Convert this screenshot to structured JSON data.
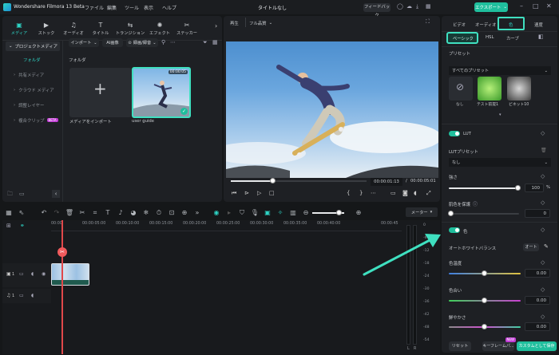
{
  "titlebar": {
    "app": "Wondershare Filmora 13 Beta",
    "menus": [
      "ファイル",
      "編集",
      "ツール",
      "表示",
      "ヘルプ"
    ],
    "project": "タイトルなし",
    "feedback": "フィードバック",
    "export": "エクスポート"
  },
  "media_tabs": [
    {
      "label": "メディア",
      "icon": "media-icon"
    },
    {
      "label": "ストック",
      "icon": "stock-icon"
    },
    {
      "label": "オーディオ",
      "icon": "audio-icon"
    },
    {
      "label": "タイトル",
      "icon": "title-icon"
    },
    {
      "label": "トランジション",
      "icon": "transition-icon"
    },
    {
      "label": "エフェクト",
      "icon": "effect-icon"
    },
    {
      "label": "ステッカー",
      "icon": "sticker-icon"
    }
  ],
  "sidebar": {
    "project_media": "プロジェクトメディア",
    "folder": "フォルダ",
    "items": [
      "共有メディア",
      "クラウド メディア",
      "調整レイヤー",
      "複合クリップ"
    ],
    "beta_badge": "BETA"
  },
  "media_toolbar": {
    "import": "インポート",
    "ai_image": "AI画像",
    "sort": "録画/録音",
    "folder_label": "フォルダ"
  },
  "media_items": [
    {
      "label": "メディアをインポート"
    },
    {
      "label": "user guide",
      "duration": "00:00:05"
    }
  ],
  "player": {
    "tab1": "再生",
    "tab2": "フル品質",
    "current": "00:00:01:13",
    "total": "00:00:05:01"
  },
  "right": {
    "tabs": [
      "ビデオ",
      "オーディオ",
      "色",
      "速度"
    ],
    "subtabs": [
      "ベーシック",
      "HSL",
      "カーブ"
    ],
    "preset_title": "プリセット",
    "preset_select": "すべてのプリセット",
    "presets": [
      "なし",
      "テスト前提1",
      "ビネット10"
    ],
    "lut": "LUT",
    "lut_preset": "LUTプリセット",
    "lut_none": "なし",
    "strength": "強さ",
    "strength_val": "100",
    "strength_pct": "%",
    "skin": "肌色を保護",
    "skin_val": "0",
    "color": "色",
    "white_balance": "オートホワイトバランス",
    "auto": "オート",
    "temp": "色温度",
    "temp_val": "0.00",
    "tint": "色合い",
    "tint_val": "0.00",
    "vivid": "鮮やかさ",
    "vivid_val": "0.00",
    "reset": "リセット",
    "keyframe": "キーフレームパ...",
    "keyframe_badge": "NEW",
    "save_custom": "カスタムとして保存"
  },
  "timeline": {
    "meter": "メーター",
    "times": [
      "00:00",
      "00:00:05:00",
      "00:00:10:00",
      "00:00:15:00",
      "00:00:20:00",
      "00:00:25:00",
      "00:00:30:00",
      "00:00:35:00",
      "00:00:40:00",
      "00:00:45"
    ],
    "db": [
      "0",
      "-6",
      "-12",
      "-18",
      "-24",
      "-30",
      "-36",
      "-42",
      "-48",
      "-54"
    ],
    "lr": [
      "L",
      "R"
    ],
    "track_v": "1",
    "track_a": "1"
  },
  "colors": {
    "accent": "#1fbf9d",
    "highlight": "#3fe0c0"
  }
}
